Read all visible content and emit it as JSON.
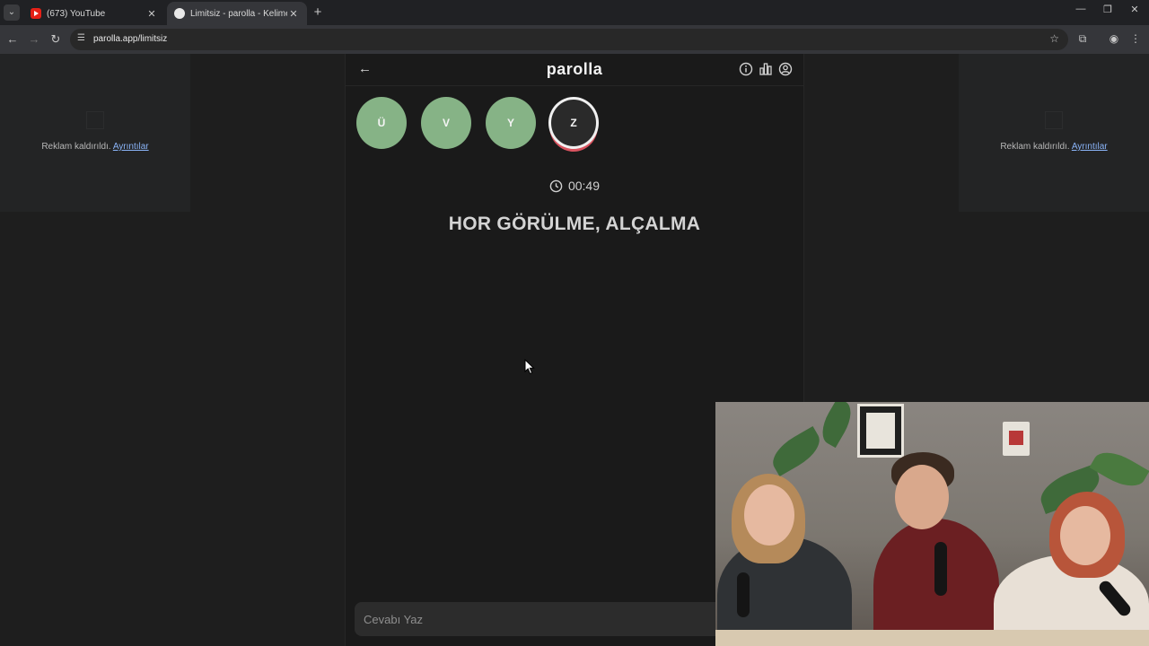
{
  "browser": {
    "tabs": [
      {
        "title": "(673) YouTube",
        "active": false,
        "favicon": "youtube-icon"
      },
      {
        "title": "Limitsiz - parolla - Kelime oyunu",
        "active": true,
        "favicon": "parolla-icon"
      }
    ],
    "url": "parolla.app/limitsiz"
  },
  "ads": {
    "left_text": "Reklam kaldırıldı.",
    "left_link": "Ayrıntılar",
    "right_text": "Reklam kaldırıldı.",
    "right_link": "Ayrıntılar"
  },
  "app": {
    "logo": "parolla",
    "letters": [
      {
        "letter": "Ü",
        "state": "answered"
      },
      {
        "letter": "V",
        "state": "answered"
      },
      {
        "letter": "Y",
        "state": "answered"
      },
      {
        "letter": "Z",
        "state": "current"
      }
    ],
    "timer": "00:49",
    "question": "HOR GÖRÜLME, ALÇALMA",
    "answer_placeholder": "Cevabı Yaz"
  },
  "colors": {
    "answered_letter": "#86b386",
    "current_ring": "#f0f0f0",
    "current_accent": "#d9535f",
    "background": "#1a1a1a"
  }
}
